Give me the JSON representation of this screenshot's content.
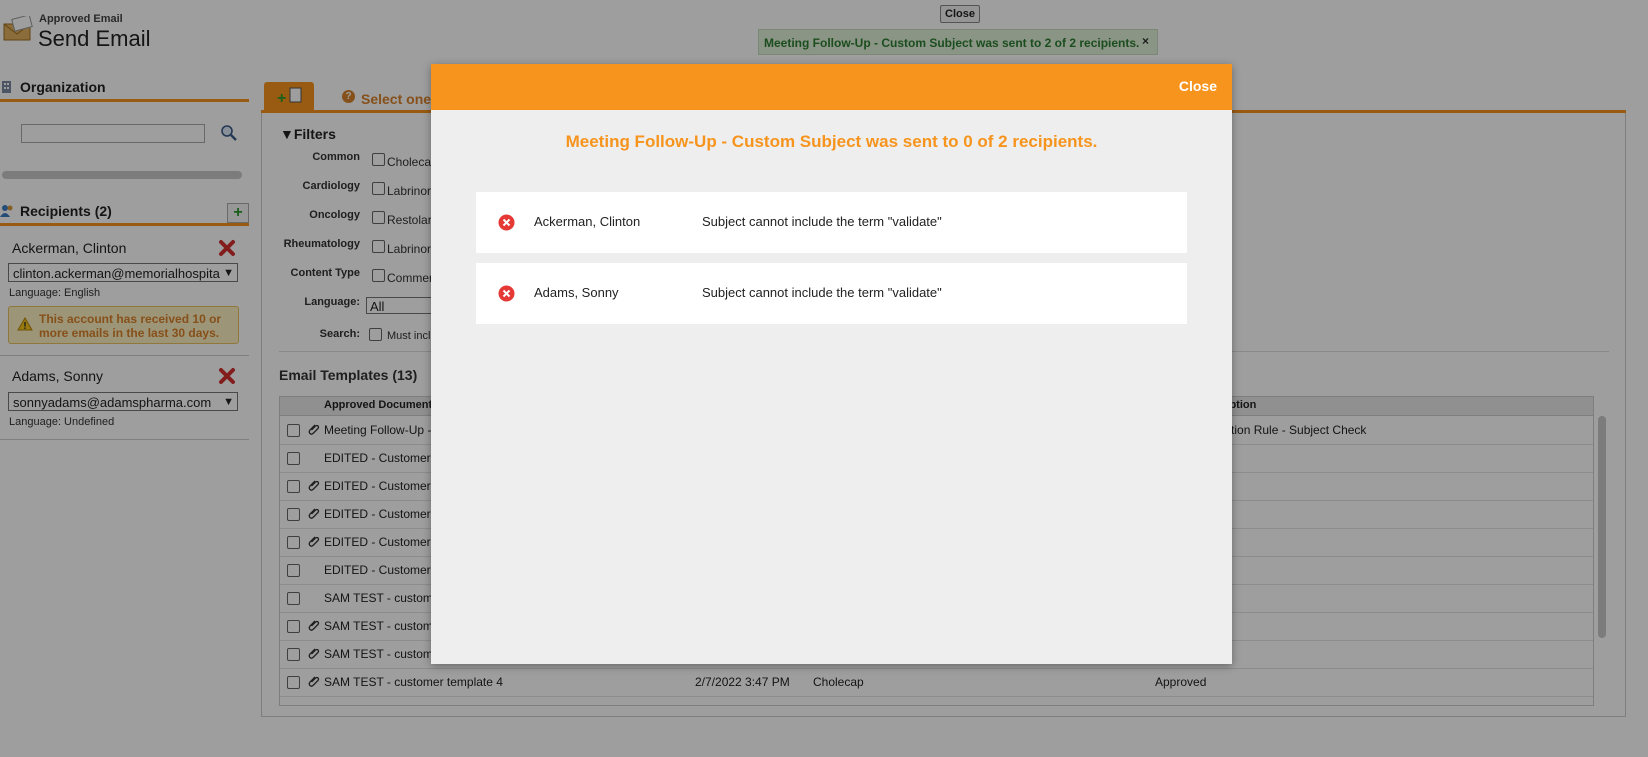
{
  "header": {
    "subtitle": "Approved Email",
    "title": "Send Email",
    "top_close": "Close",
    "toast": "Meeting Follow-Up - Custom Subject was sent to 2 of 2 recipients.",
    "toast_close": "×"
  },
  "sidebar": {
    "organization_label": "Organization",
    "recipients_label": "Recipients (2)",
    "add_label": "+",
    "recipients": [
      {
        "name": "Ackerman, Clinton",
        "email": "clinton.ackerman@memorialhospita",
        "language": "Language: English"
      },
      {
        "name": "Adams, Sonny",
        "email": "sonnyadams@adamspharma.com",
        "language": "Language: Undefined"
      }
    ],
    "warning": "This account has received 10 or more emails in the last 30 days."
  },
  "main": {
    "tab_label": "Select one",
    "filters_title": "▼Filters",
    "filters": [
      {
        "label": "Common",
        "value": "Cholecap"
      },
      {
        "label": "Cardiology",
        "value": "Labrinor"
      },
      {
        "label": "Oncology",
        "value": "Restolar"
      },
      {
        "label": "Rheumatology",
        "value": "Labrinor"
      },
      {
        "label": "Content Type",
        "value": "Commer"
      }
    ],
    "language_label": "Language:",
    "language_value": "All",
    "search_label": "Search:",
    "search_option": "Must incl",
    "templates_title": "Email Templates (13)",
    "columns": {
      "doc": "Approved Document",
      "description": "cription"
    },
    "rows": [
      {
        "name": "Meeting Follow-Up -",
        "date": "",
        "product": "",
        "status": "idation Rule - Subject Check",
        "clip": true
      },
      {
        "name": "EDITED - Customer",
        "date": "",
        "product": "",
        "status": "",
        "clip": false
      },
      {
        "name": "EDITED - Customer",
        "date": "",
        "product": "",
        "status": "",
        "clip": true
      },
      {
        "name": "EDITED - Customer",
        "date": "",
        "product": "",
        "status": "",
        "clip": true
      },
      {
        "name": "EDITED - Customer",
        "date": "",
        "product": "",
        "status": "",
        "clip": true
      },
      {
        "name": "EDITED - Customer",
        "date": "",
        "product": "",
        "status": "",
        "clip": false
      },
      {
        "name": "SAM TEST - custom",
        "date": "",
        "product": "",
        "status": "",
        "clip": false
      },
      {
        "name": "SAM TEST - custom",
        "date": "",
        "product": "",
        "status": "",
        "clip": true
      },
      {
        "name": "SAM TEST - custom",
        "date": "",
        "product": "",
        "status": "",
        "clip": true
      },
      {
        "name": "SAM TEST - customer template 4",
        "date": "2/7/2022 3:47 PM",
        "product": "Cholecap",
        "status": "Approved",
        "clip": true
      }
    ]
  },
  "modal": {
    "close_label": "Close",
    "title": "Meeting Follow-Up - Custom Subject was sent to 0 of 2 recipients.",
    "errors": [
      {
        "name": "Ackerman, Clinton",
        "message": "Subject cannot include the term \"validate\""
      },
      {
        "name": "Adams, Sonny",
        "message": "Subject cannot include the term \"validate\""
      }
    ]
  },
  "colors": {
    "accent": "#f7941d",
    "toast_bg": "#dff0d8",
    "error_red": "#e53935"
  }
}
